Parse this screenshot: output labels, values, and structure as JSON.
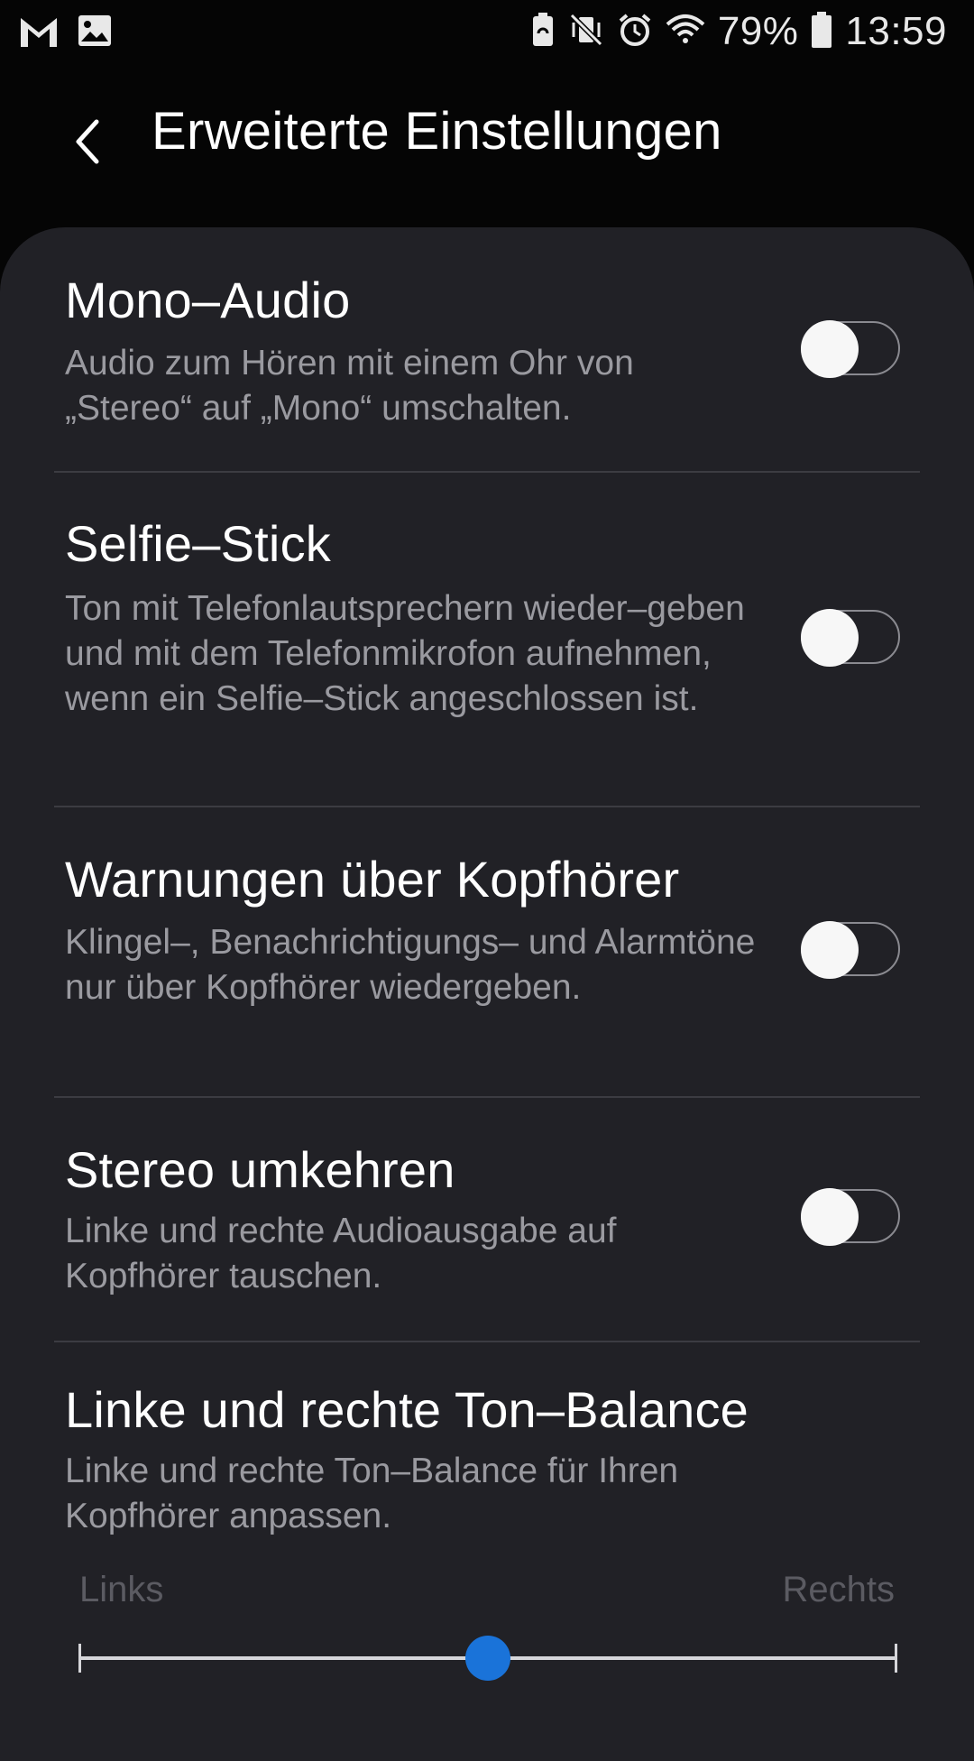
{
  "status_bar": {
    "left_icons": [
      "gmail-icon",
      "gallery-icon"
    ],
    "right_icons": [
      "battery-saver-icon",
      "vibrate-mute-icon",
      "alarm-icon",
      "wifi-icon",
      "battery-icon"
    ],
    "battery_percent": "79%",
    "time": "13:59"
  },
  "header": {
    "back_icon": "chevron-left-icon",
    "title": "Erweiterte Einstellungen"
  },
  "settings": [
    {
      "title": "Mono–Audio",
      "description": "Audio zum Hören mit einem Ohr von „Stereo“ auf „Mono“ umschalten.",
      "enabled": false
    },
    {
      "title": "Selfie–Stick",
      "description": "Ton mit Telefonlautsprechern wieder–geben und mit dem Telefonmikrofon aufnehmen, wenn ein Selfie–Stick angeschlossen ist.",
      "enabled": false
    },
    {
      "title": "Warnungen über Kopfhörer",
      "description": "Klingel–, Benachrichtigungs– und Alarmtöne nur über Kopfhörer wiedergeben.",
      "enabled": false
    },
    {
      "title": "Stereo umkehren",
      "description": "Linke und rechte Audioausgabe auf Kopfhörer tauschen.",
      "enabled": false
    }
  ],
  "balance": {
    "title": "Linke und rechte Ton–Balance",
    "description": "Linke und rechte Ton–Balance für Ihren Kopfhörer anpassen.",
    "left_label": "Links",
    "right_label": "Rechts",
    "value": 0.5
  },
  "colors": {
    "background": "#050505",
    "card": "#212126",
    "accent": "#1a73d9",
    "secondary_text": "#9a9aa0"
  }
}
